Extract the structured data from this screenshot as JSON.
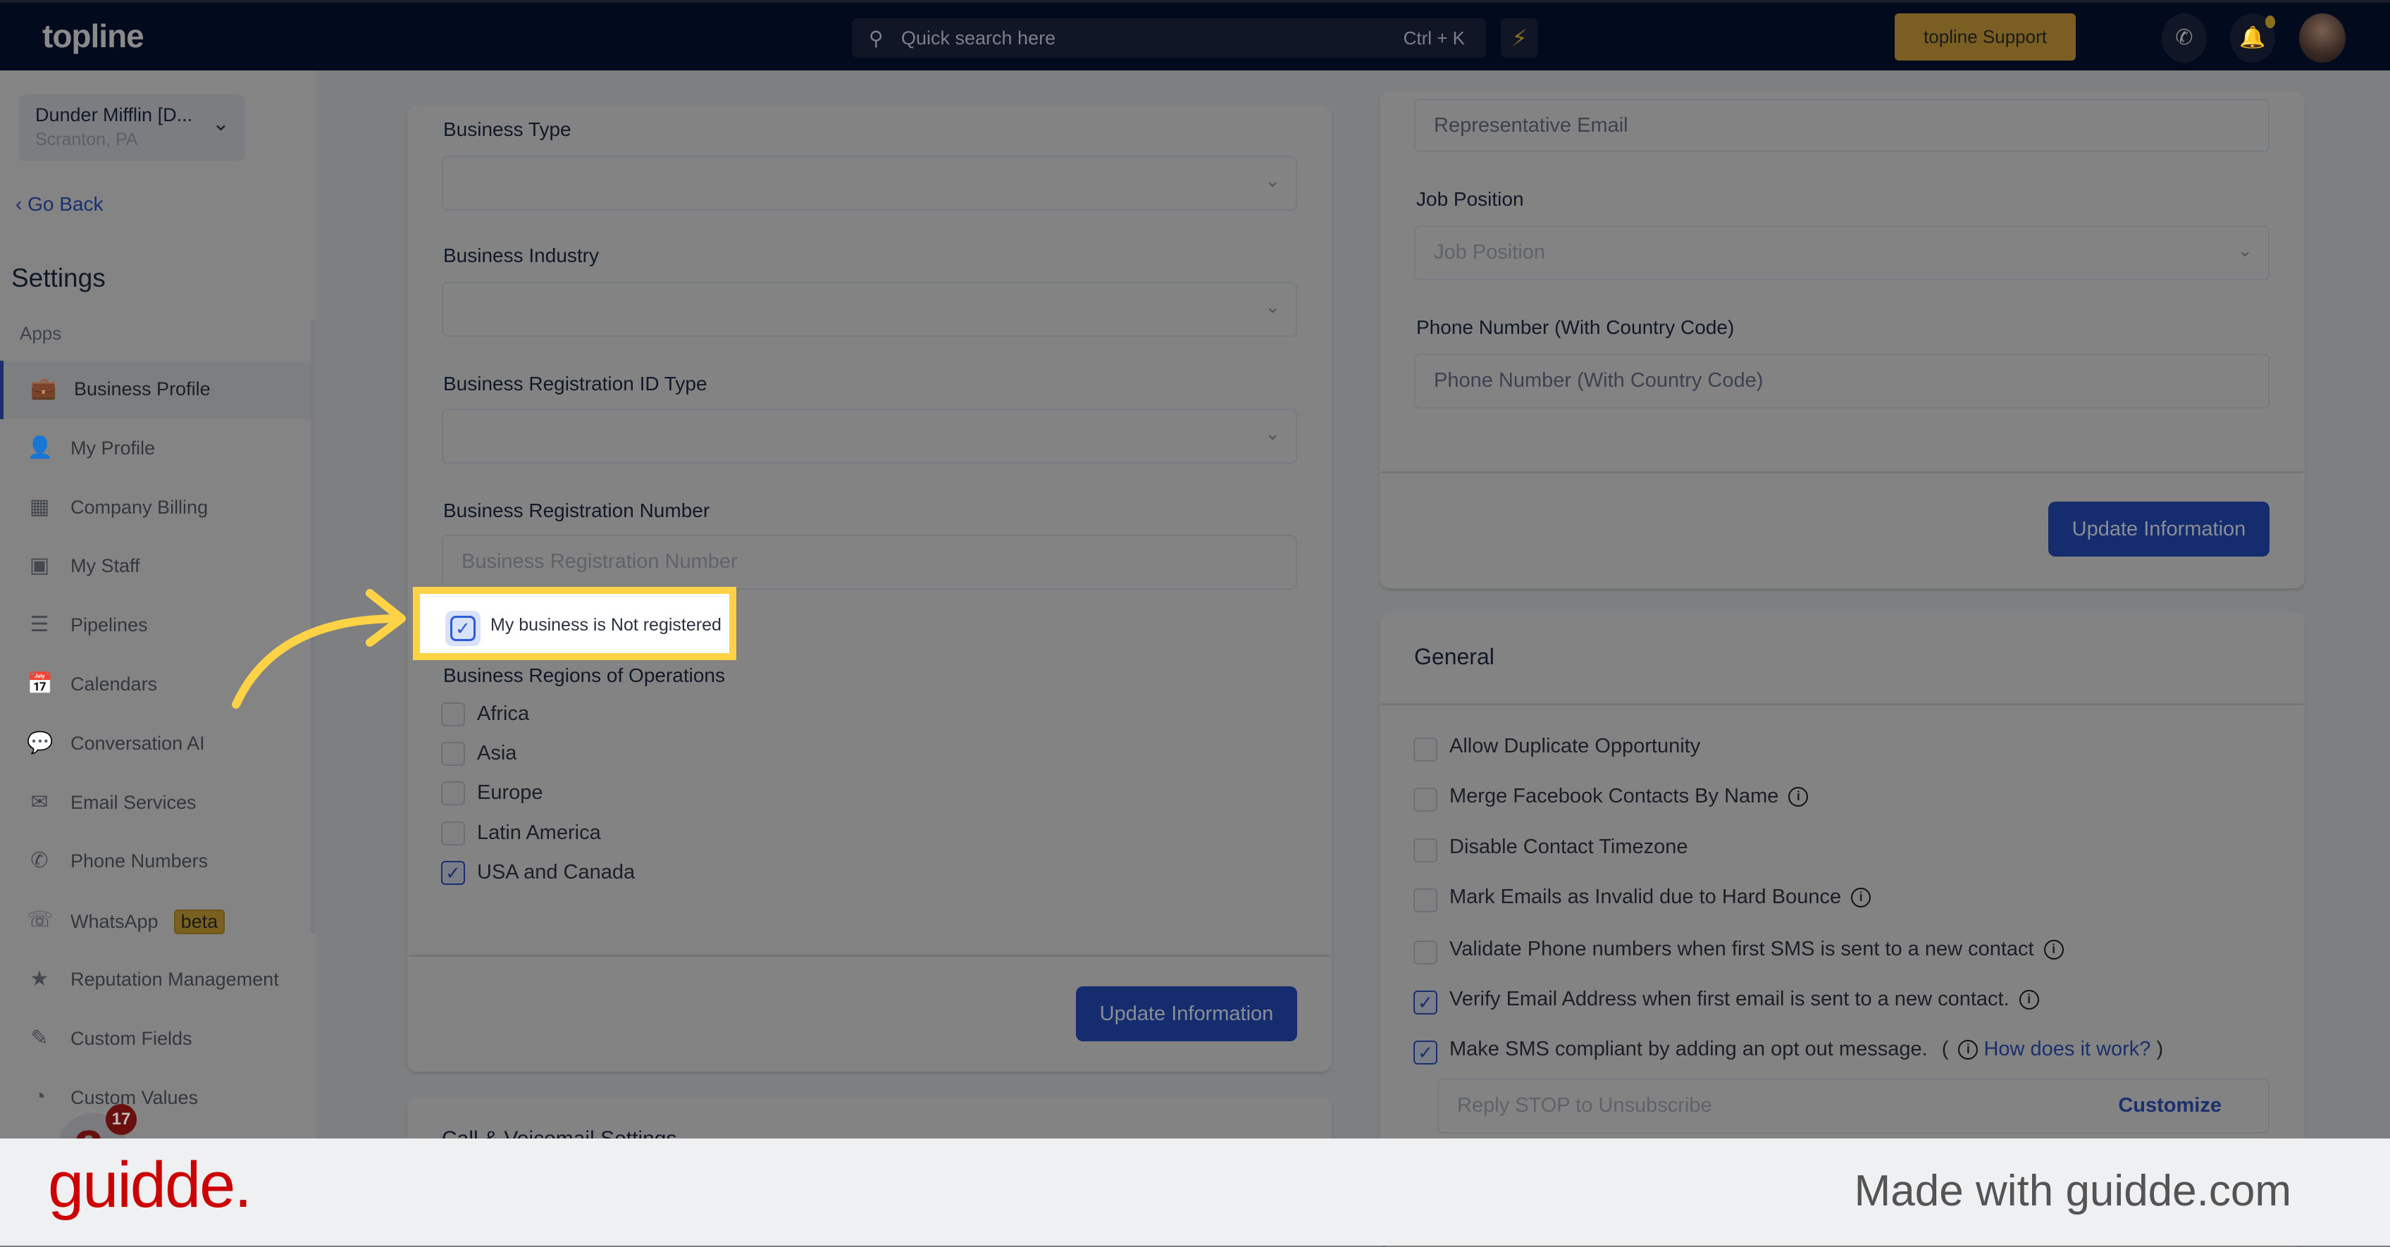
{
  "header": {
    "logo": "topline",
    "search_placeholder": "Quick search here",
    "search_shortcut": "Ctrl + K",
    "support_label": "topline Support"
  },
  "sidebar": {
    "account_name": "Dunder Mifflin [D...",
    "account_location": "Scranton, PA",
    "go_back": "Go Back",
    "title": "Settings",
    "section": "Apps",
    "items": [
      {
        "label": "Business Profile",
        "icon": "briefcase-icon",
        "active": true
      },
      {
        "label": "My Profile",
        "icon": "user-icon"
      },
      {
        "label": "Company Billing",
        "icon": "billing-grid-icon"
      },
      {
        "label": "My Staff",
        "icon": "staff-icon"
      },
      {
        "label": "Pipelines",
        "icon": "pipeline-icon"
      },
      {
        "label": "Calendars",
        "icon": "calendar-icon"
      },
      {
        "label": "Conversation AI",
        "icon": "chat-bubbles-icon"
      },
      {
        "label": "Email Services",
        "icon": "envelope-icon"
      },
      {
        "label": "Phone Numbers",
        "icon": "phone-icon"
      },
      {
        "label": "WhatsApp",
        "icon": "whatsapp-icon",
        "badge": "beta"
      },
      {
        "label": "Reputation Management",
        "icon": "star-sparkle-icon"
      },
      {
        "label": "Custom Fields",
        "icon": "edit-field-icon"
      },
      {
        "label": "Custom Values",
        "icon": "pie-icon"
      }
    ],
    "chat_badge": "17"
  },
  "business_form": {
    "business_type_label": "Business Type",
    "business_industry_label": "Business Industry",
    "reg_id_type_label": "Business Registration ID Type",
    "reg_number_label": "Business Registration Number",
    "reg_number_placeholder": "Business Registration Number",
    "not_registered_label": "My business is Not registered",
    "not_registered_checked": true,
    "regions_label": "Business Regions of Operations",
    "regions": [
      {
        "label": "Africa",
        "checked": false
      },
      {
        "label": "Asia",
        "checked": false
      },
      {
        "label": "Europe",
        "checked": false
      },
      {
        "label": "Latin America",
        "checked": false
      },
      {
        "label": "USA and Canada",
        "checked": true
      }
    ],
    "update_button": "Update Information",
    "next_section_title": "Call & Voicemail Settings"
  },
  "representative": {
    "email_placeholder": "Representative Email",
    "job_label": "Job Position",
    "job_placeholder": "Job Position",
    "phone_label": "Phone Number (With Country Code)",
    "phone_placeholder": "Phone Number (With Country Code)",
    "update_button": "Update Information"
  },
  "general": {
    "title": "General",
    "options": [
      {
        "label": "Allow Duplicate Opportunity",
        "checked": false,
        "info": false
      },
      {
        "label": "Merge Facebook Contacts By Name",
        "checked": false,
        "info": true
      },
      {
        "label": "Disable Contact Timezone",
        "checked": false,
        "info": false
      },
      {
        "label": "Mark Emails as Invalid due to Hard Bounce",
        "checked": false,
        "info": true
      },
      {
        "label": "Validate Phone numbers when first SMS is sent to a new contact",
        "checked": false,
        "info": true
      },
      {
        "label": "Verify Email Address when first email is sent to a new contact.",
        "checked": true,
        "info": true
      },
      {
        "label": "Make SMS compliant by adding an opt out message.",
        "checked": true,
        "info": true
      }
    ],
    "how_link": "How does it work?",
    "opt_out_placeholder": "Reply STOP to Unsubscribe",
    "customize": "Customize"
  },
  "footer": {
    "brand": "guidde.",
    "made_with": "Made with guidde.com"
  },
  "colors": {
    "highlight": "#ffd345",
    "primary": "#152d6e",
    "brand_red": "#cc0000"
  }
}
